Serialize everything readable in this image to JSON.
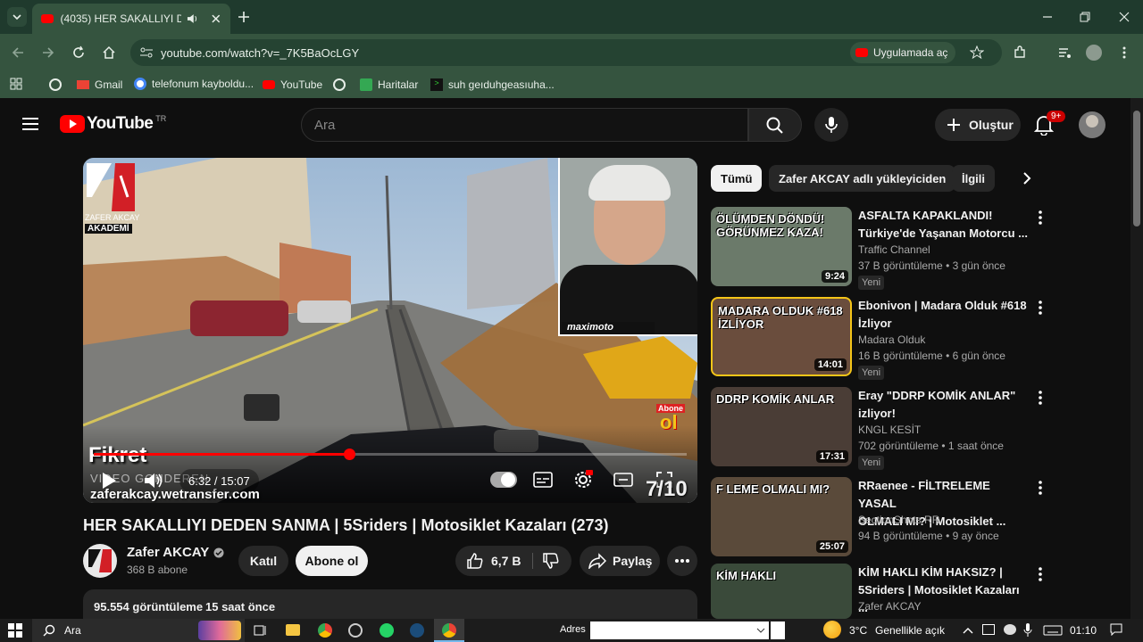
{
  "browser": {
    "tab_title": "(4035) HER SAKALLIYI DEDE",
    "url": "youtube.com/watch?v=_7K5BaOcLGY",
    "open_in_app": "Uygulamada aç",
    "bookmarks": [
      "Gmail",
      "telefonum kayboldu...",
      "YouTube",
      "Haritalar",
      "suh geıduhgeasıuha..."
    ]
  },
  "youtube": {
    "logo_text": "YouTube",
    "country": "TR",
    "search_placeholder": "Ara",
    "create_label": "Oluştur",
    "notif_count": "9+"
  },
  "player": {
    "channel_logo_line1": "ZAFER AKCAY",
    "channel_logo_line2": "AKADEMİ",
    "overlay_name": "Fikret",
    "overlay_line2": "VIDEO GONDEREN",
    "overlay_link": "zaferakcay.wetransfer.com",
    "time": "6:32 / 15:07",
    "rating": "7/10",
    "subscribe_badge_top": "Abone",
    "subscribe_badge_bottom": "ol",
    "cam_brand": "maximoto",
    "progress": 0.43
  },
  "video": {
    "title": "HER SAKALLIYI DEDEN SANMA | 5Sriders | Motosiklet Kazaları (273)",
    "channel": "Zafer AKCAY",
    "subscribers": "368 B abone",
    "join": "Katıl",
    "subscribe": "Abone ol",
    "likes": "6,7 B",
    "share": "Paylaş",
    "views": "95.554 görüntüleme",
    "ago": "15 saat önce"
  },
  "chips": [
    "Tümü",
    "Zafer AKCAY adlı yükleyiciden",
    "İlgili"
  ],
  "recommendations": [
    {
      "title1": "ASFALTA KAPAKLANDI!",
      "title2": "Türkiye'de Yaşanan Motorcu ...",
      "channel": "Traffic Channel",
      "meta": "37 B görüntüleme • 3 gün önce",
      "badge": "Yeni",
      "duration": "9:24",
      "thumb_text": "ÖLÜMDEN DÖNDÜ! GÖRÜNMEZ KAZA!",
      "thumb_color": "#6b7a6a"
    },
    {
      "title1": "Ebonivon | Madara Olduk #618",
      "title2": "İzliyor",
      "channel": "Madara Olduk",
      "meta": "16 B görüntüleme • 6 gün önce",
      "badge": "Yeni",
      "duration": "14:01",
      "thumb_text": "MADARA OLDUK #618 İZLİYOR",
      "thumb_color": "#6a4d3d"
    },
    {
      "title1": "Eray \"DDRP KOMİK ANLAR\"",
      "title2": "izliyor!",
      "channel": "KNGL KESİT",
      "meta": "702 görüntüleme • 1 saat önce",
      "badge": "Yeni",
      "duration": "17:31",
      "thumb_text": "DDRP KOMİK ANLAR",
      "thumb_color": "#4a3d36"
    },
    {
      "title1": "RRaenee - FİLTRELEME YASAL",
      "title2": "OLMALI MI? | Motosiklet ...",
      "channel": "SectionShots RR",
      "meta": "94 B görüntüleme • 9 ay önce",
      "badge": "",
      "duration": "25:07",
      "thumb_text": "F LEME OLMALI MI?",
      "thumb_color": "#5a4a3a"
    },
    {
      "title1": "KİM HAKLI KİM HAKSIZ? |",
      "title2": "5Sriders | Motosiklet Kazaları ...",
      "channel": "Zafer AKCAY",
      "meta": "",
      "badge": "",
      "duration": "",
      "thumb_text": "KİM HAKLI",
      "thumb_color": "#3a4a3a"
    }
  ],
  "taskbar": {
    "search": "Ara",
    "address_label": "Adres",
    "weather": "3°C",
    "weather_text": "Genellikle açık",
    "time": "01:10"
  }
}
